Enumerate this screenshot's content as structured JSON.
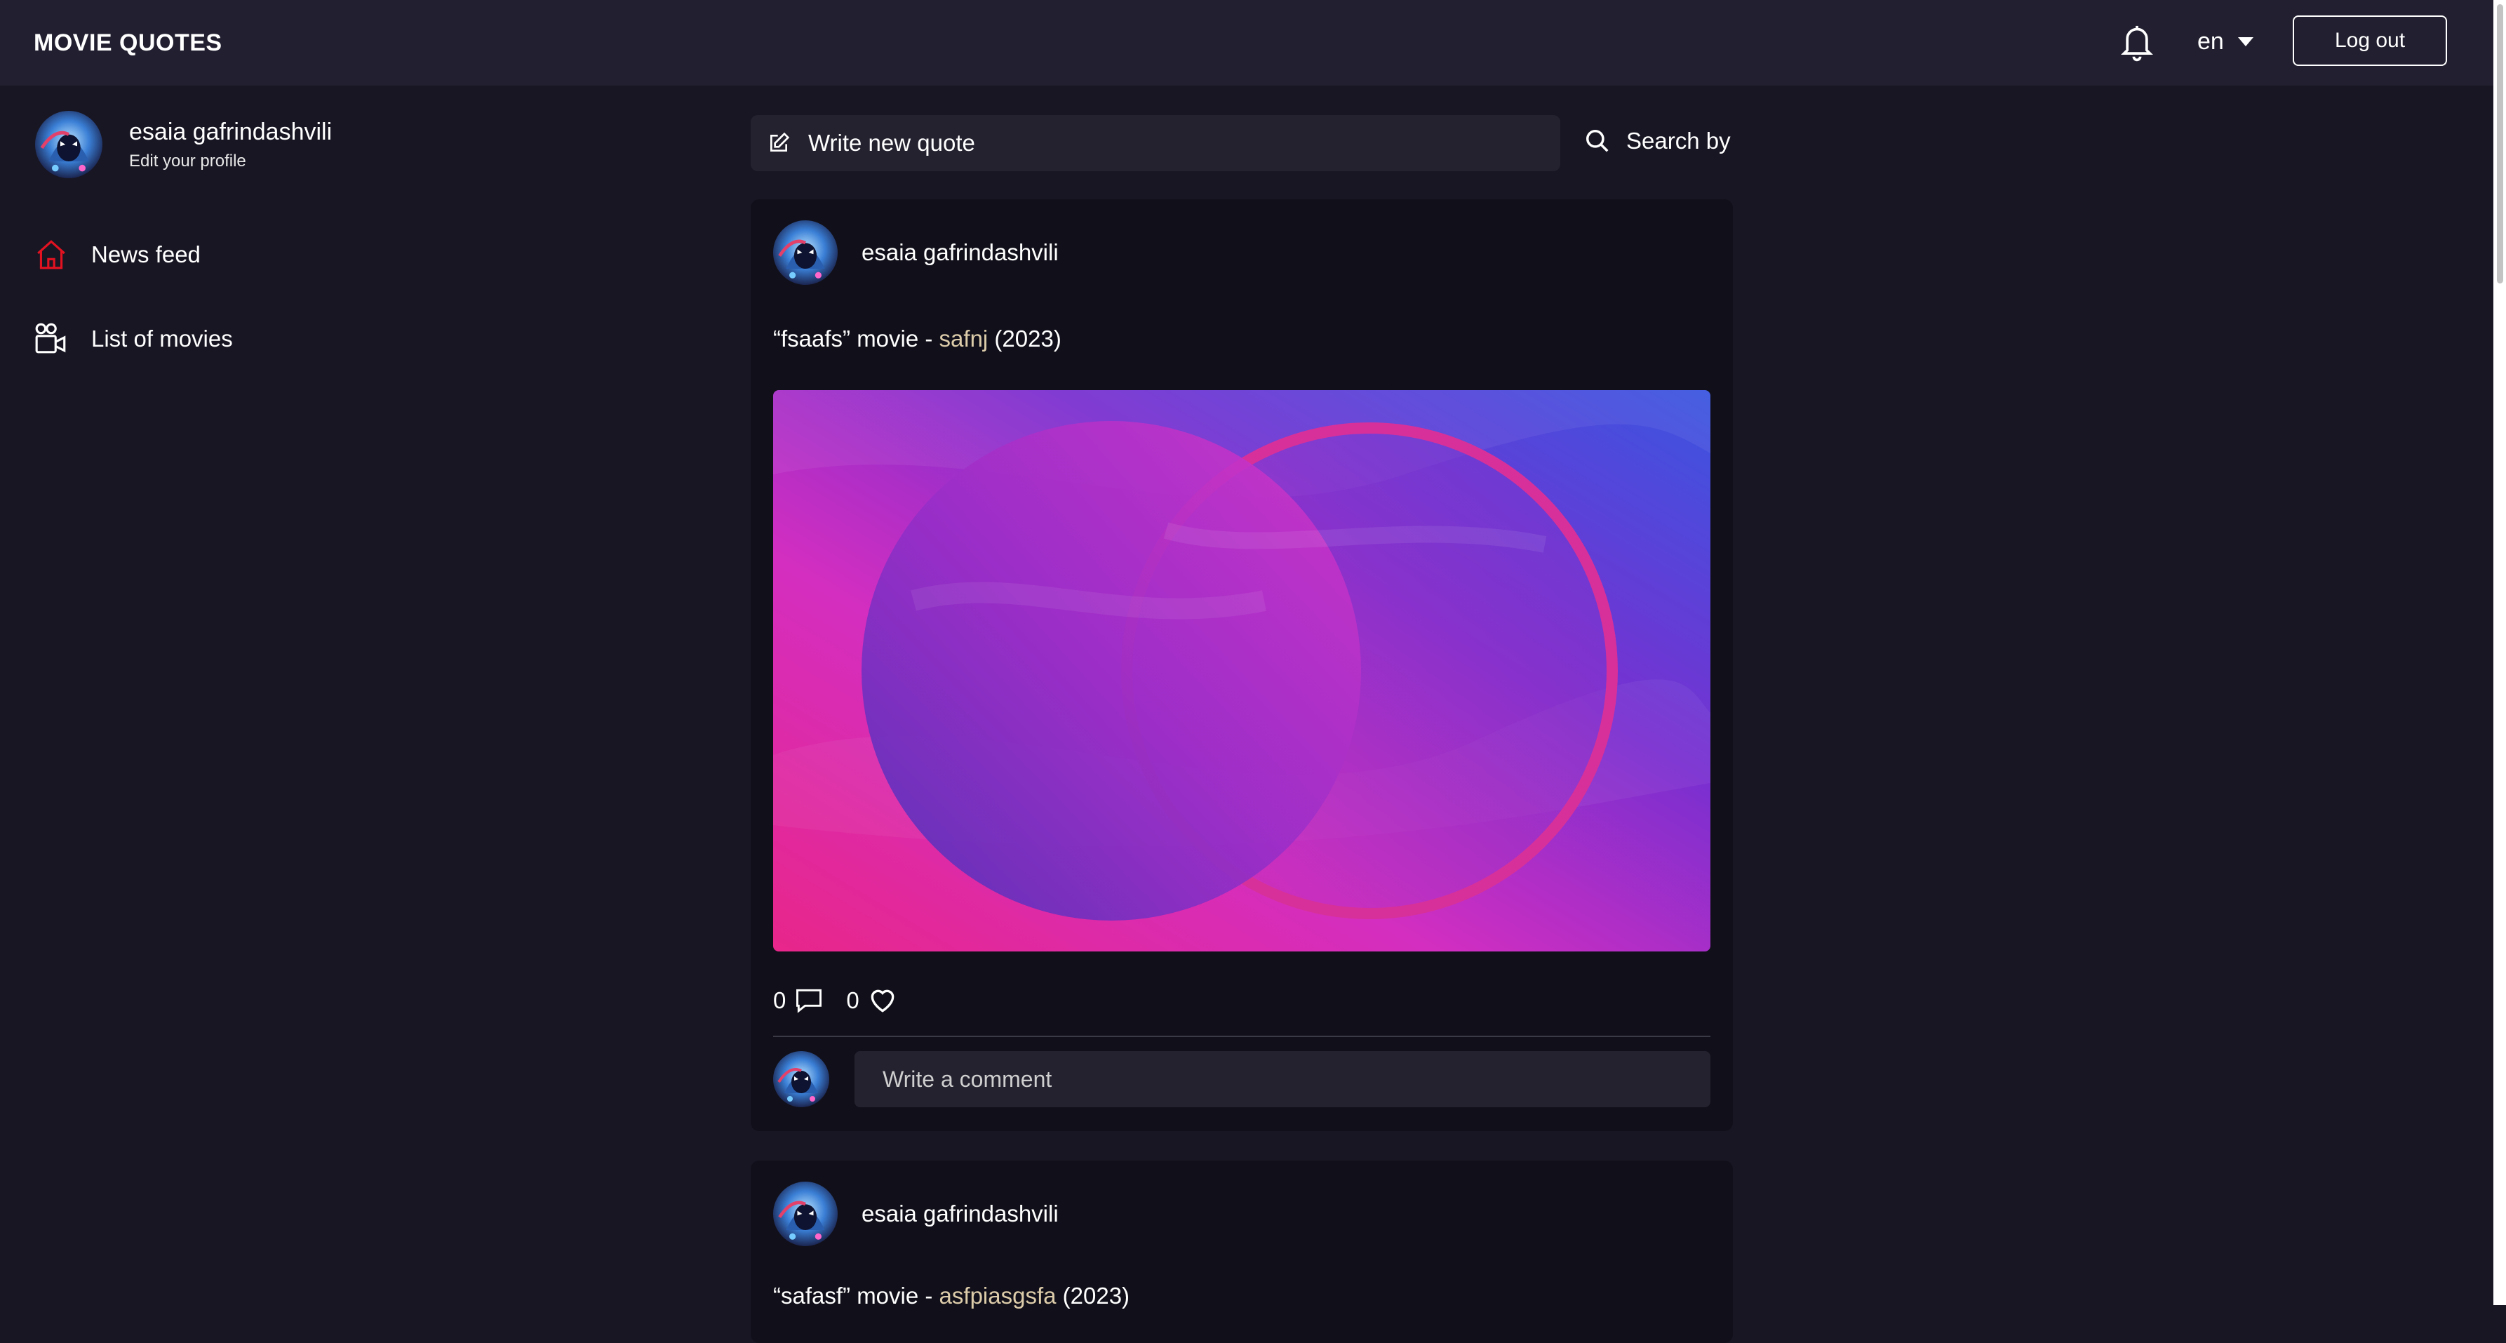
{
  "header": {
    "logo": "MOVIE QUOTES",
    "language": "en",
    "logout_label": "Log out"
  },
  "sidebar": {
    "user_name": "esaia gafrindashvili",
    "edit_profile": "Edit your profile",
    "items": [
      {
        "label": "News feed",
        "icon": "home-icon",
        "active": true
      },
      {
        "label": "List of movies",
        "icon": "movie-camera-icon",
        "active": false
      }
    ]
  },
  "main": {
    "write_quote_label": "Write new quote",
    "search_label": "Search by"
  },
  "posts": [
    {
      "author": "esaia gafrindashvili",
      "quote_open": "“fsaafs” movie - ",
      "movie_title": "safnj",
      "year": " (2023)",
      "comments_count": "0",
      "likes_count": "0",
      "comment_placeholder": "Write a comment"
    },
    {
      "author": "esaia gafrindashvili",
      "quote_open": "“safasf” movie - ",
      "movie_title": "asfpiasgsfa",
      "year": " (2023)"
    }
  ],
  "colors": {
    "background": "#181623",
    "header": "#222030",
    "card": "#11101a",
    "input": "#24222f",
    "movie_link": "#ddccaa",
    "active_icon": "#e31221"
  }
}
